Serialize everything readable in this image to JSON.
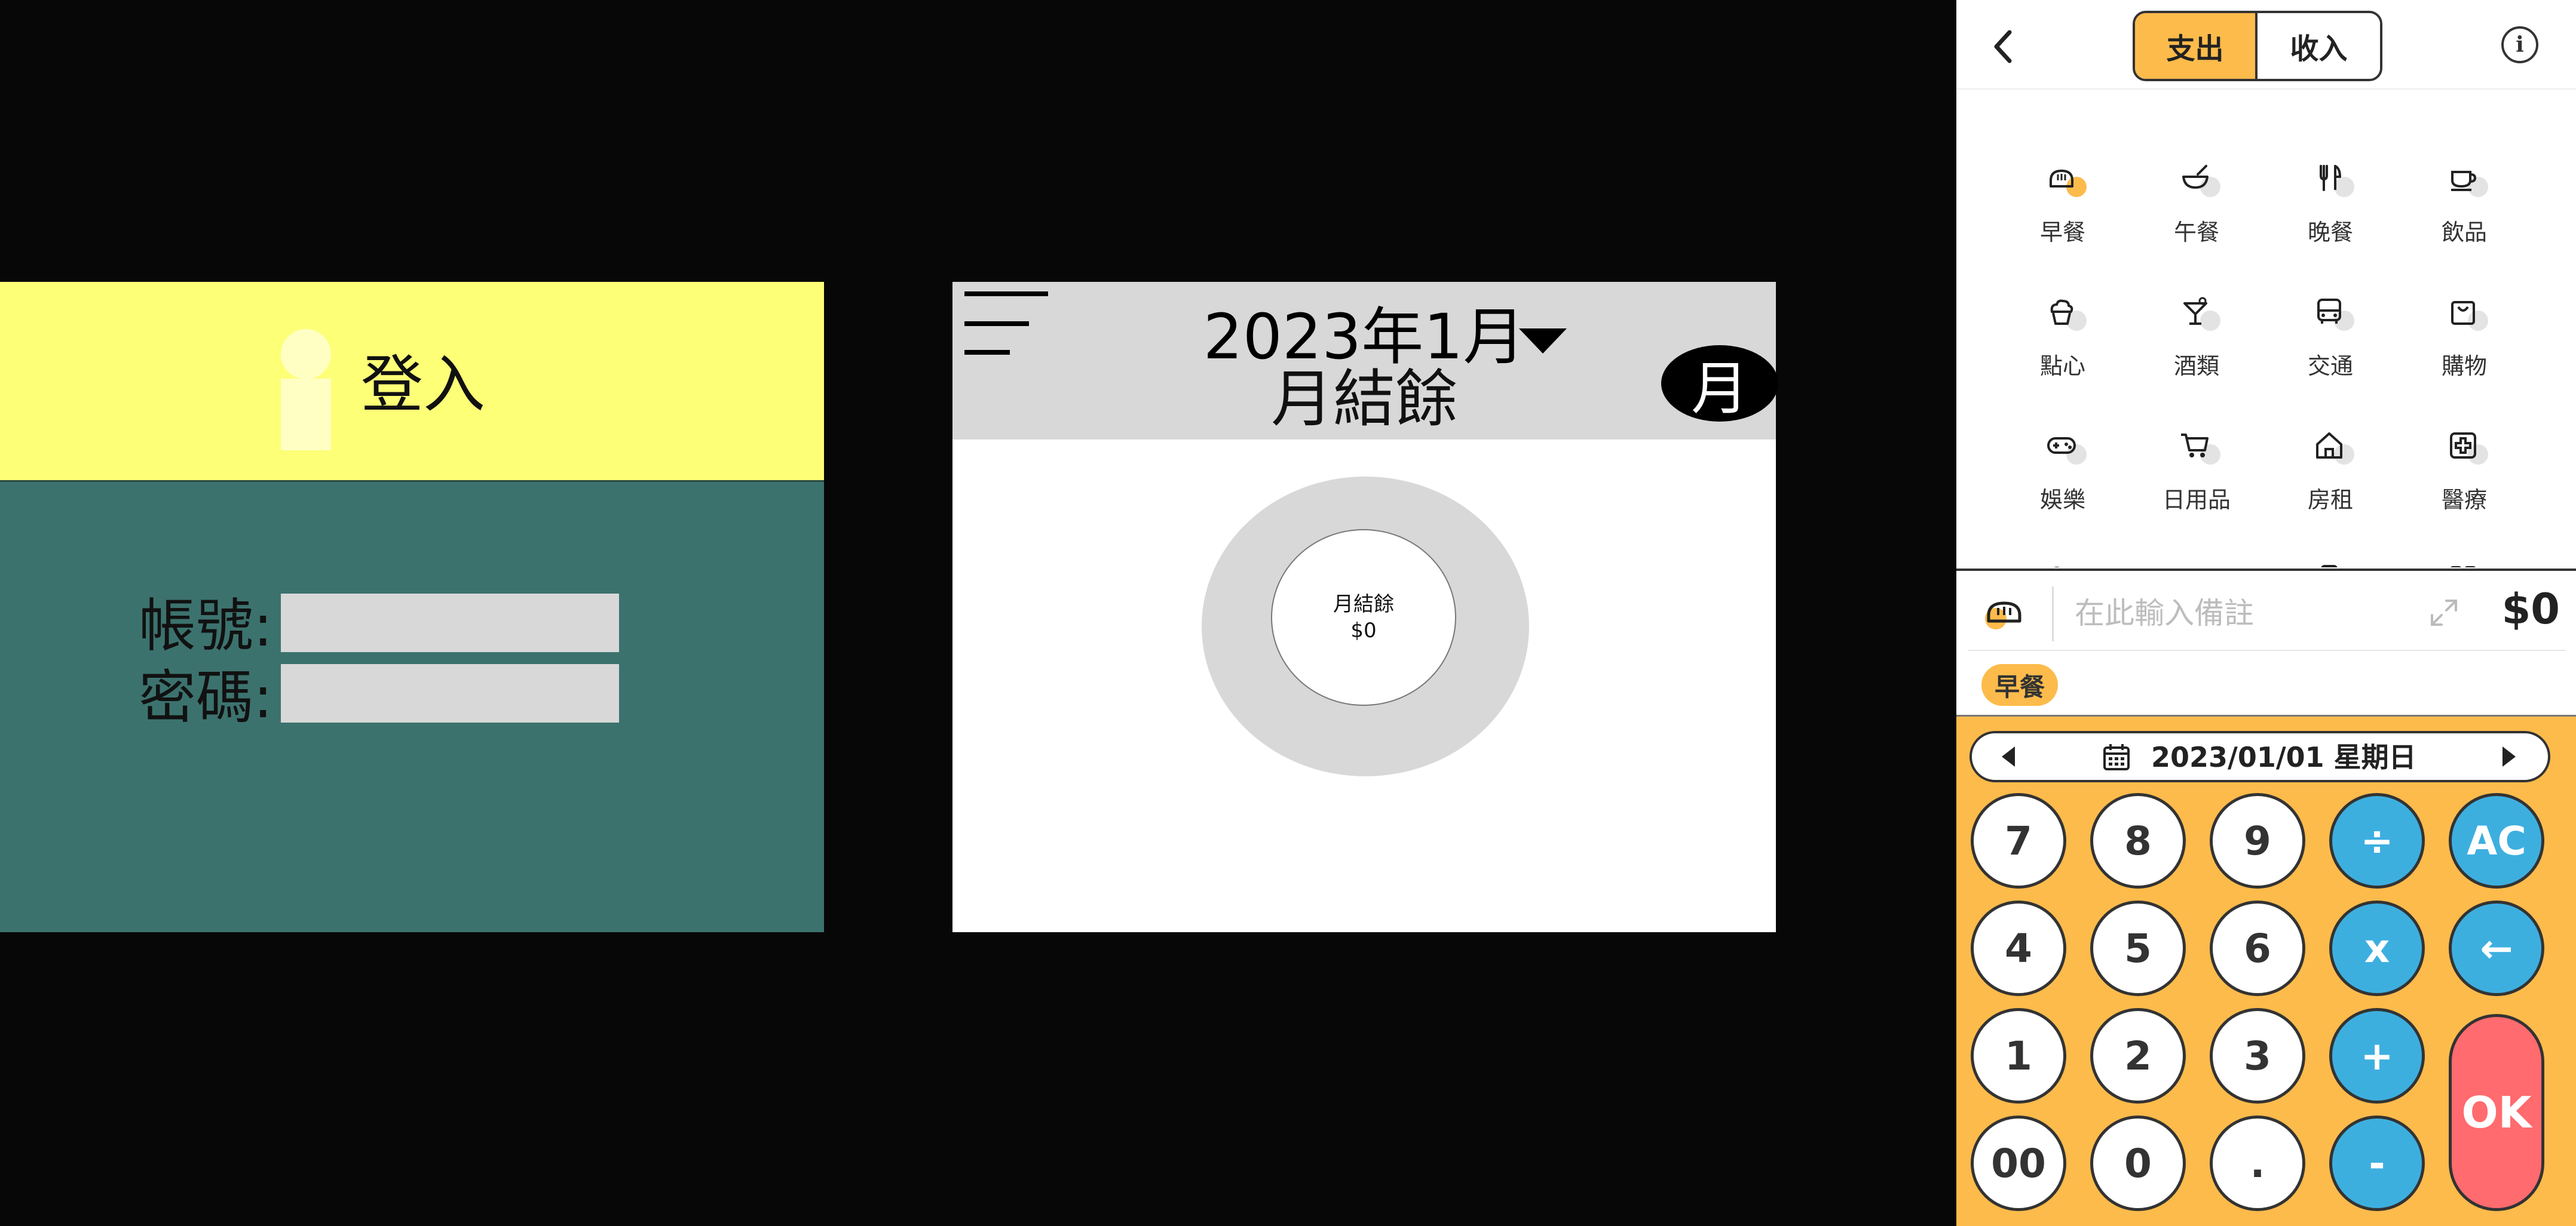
{
  "login": {
    "title": "登入",
    "username_label": "帳號:",
    "password_label": "密碼:",
    "username_value": "",
    "password_value": "",
    "colors": {
      "header": "#fdff77",
      "body": "#3c726e"
    }
  },
  "summary": {
    "month": "2023年1月",
    "balance_title": "月結餘",
    "period_toggle": "月",
    "donut_label": "月結餘",
    "donut_value": "$0"
  },
  "app": {
    "tabs": {
      "expense": "支出",
      "income": "收入",
      "active": "expense"
    },
    "info_icon": "i",
    "categories": [
      {
        "label": "早餐",
        "icon": "bread-icon",
        "highlight": true
      },
      {
        "label": "午餐",
        "icon": "bowl-icon"
      },
      {
        "label": "晚餐",
        "icon": "utensils-icon"
      },
      {
        "label": "飲品",
        "icon": "cup-icon"
      },
      {
        "label": "點心",
        "icon": "cupcake-icon"
      },
      {
        "label": "酒類",
        "icon": "cocktail-icon"
      },
      {
        "label": "交通",
        "icon": "bus-icon"
      },
      {
        "label": "購物",
        "icon": "shopping-bag-icon"
      },
      {
        "label": "娛樂",
        "icon": "gamepad-icon"
      },
      {
        "label": "日用品",
        "icon": "cart-icon"
      },
      {
        "label": "房租",
        "icon": "house-icon"
      },
      {
        "label": "醫療",
        "icon": "medical-icon"
      },
      {
        "label": "",
        "icon": "people-icon"
      },
      {
        "label": "",
        "icon": "gift-icon"
      },
      {
        "label": "",
        "icon": "phone-icon"
      },
      {
        "label": "",
        "icon": "grid-icon"
      }
    ],
    "memo": {
      "placeholder": "在此輸入備註",
      "amount": "$0",
      "tag": "早餐"
    },
    "date": "2023/01/01 星期日",
    "keys": {
      "row1": [
        "7",
        "8",
        "9",
        "÷",
        "AC"
      ],
      "row2": [
        "4",
        "5",
        "6",
        "x",
        "←"
      ],
      "row3": [
        "1",
        "2",
        "3",
        "+"
      ],
      "row4": [
        "00",
        "0",
        ".",
        "-"
      ],
      "ok": "OK"
    },
    "colors": {
      "accent": "#fdbb4b",
      "operator": "#3dafdf",
      "ok": "#ff6b6e"
    }
  }
}
